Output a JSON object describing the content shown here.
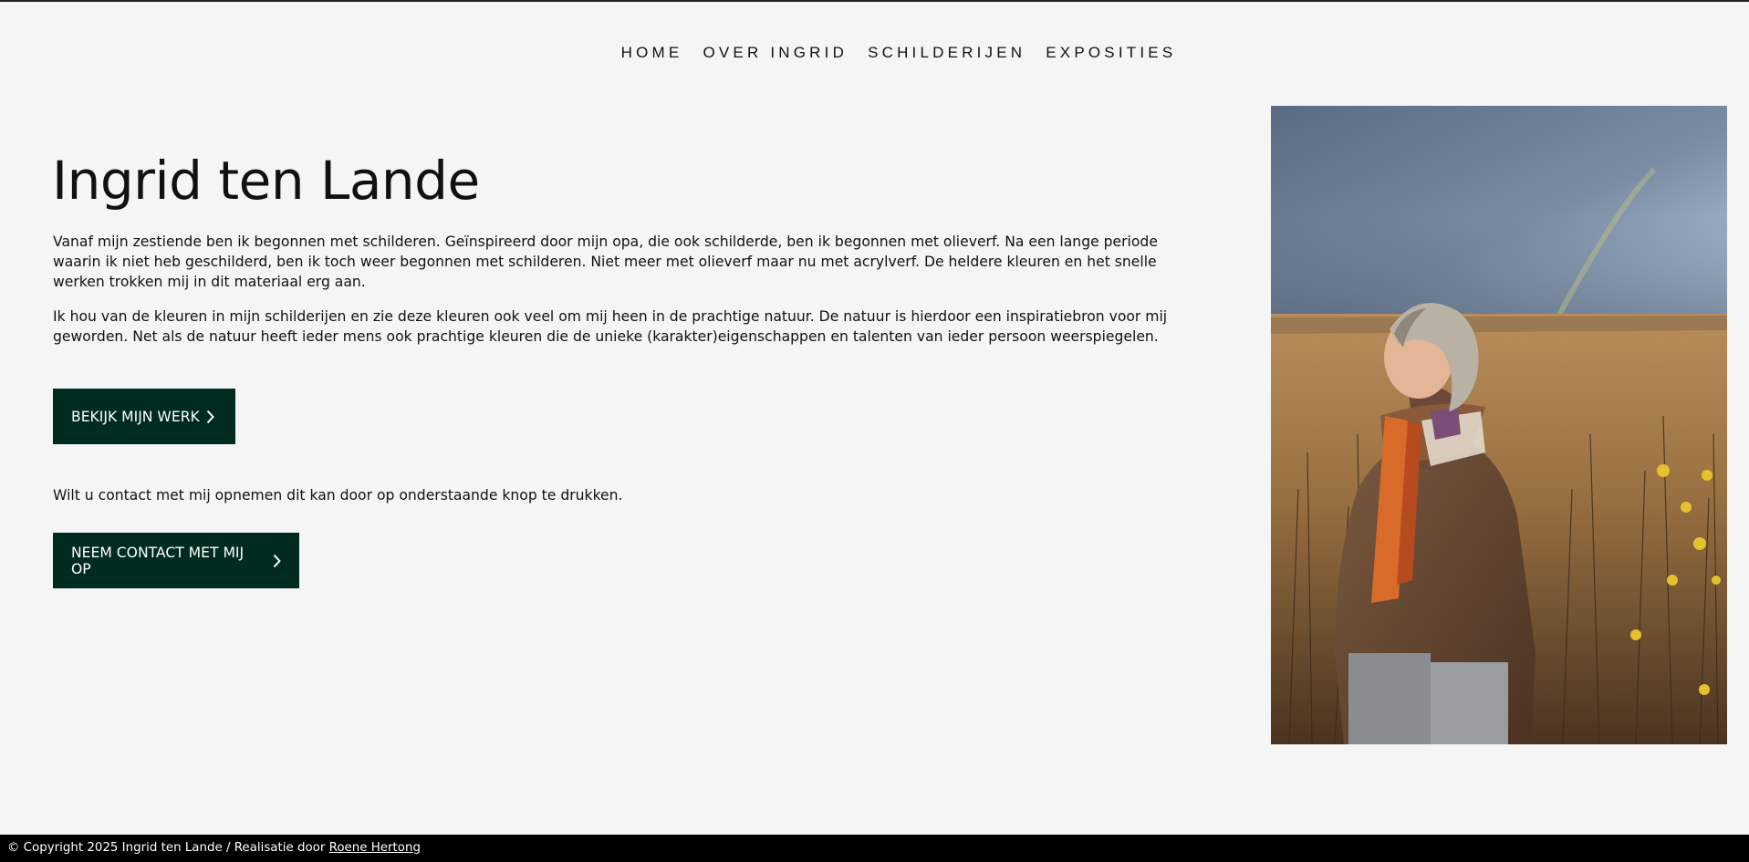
{
  "nav": {
    "items": [
      {
        "label": "HOME"
      },
      {
        "label": "OVER INGRID"
      },
      {
        "label": "SCHILDERIJEN"
      },
      {
        "label": "EXPOSITIES"
      }
    ]
  },
  "hero": {
    "title": "Ingrid ten Lande",
    "paragraph1": "Vanaf mijn zestiende ben ik begonnen met schilderen. Geïnspireerd door mijn opa, die ook schilderde, ben ik begonnen met olieverf. Na een lange periode waarin ik niet heb geschilderd, ben ik toch weer begonnen met schilderen. Niet meer met olieverf maar nu met acrylverf. De heldere kleuren en het snelle werken trokken mij in dit materiaal erg aan.",
    "paragraph2": "Ik hou van de kleuren in mijn schilderijen en zie deze kleuren ook veel om mij heen in de prachtige natuur. De natuur is hierdoor een inspiratiebron voor mij geworden. Net als de natuur heeft ieder mens ook prachtige kleuren die de unieke (karakter)eigenschappen en talenten van ieder persoon weerspiegelen.",
    "work_button": "BEKIJK MIJN WERK",
    "contact_text": "Wilt u contact met mij opnemen dit kan door op onderstaande knop te drukken.",
    "contact_button": "NEEM CONTACT MET MIJ OP"
  },
  "footer": {
    "copyright": "© Copyright 2025 Ingrid ten Lande / Realisatie door ",
    "link": "Roene Hertong"
  },
  "colors": {
    "background": "#f5f5f5",
    "button": "#002b1f",
    "footer": "#000000"
  },
  "icons": {
    "button_arrow": "chevron-right-icon"
  }
}
